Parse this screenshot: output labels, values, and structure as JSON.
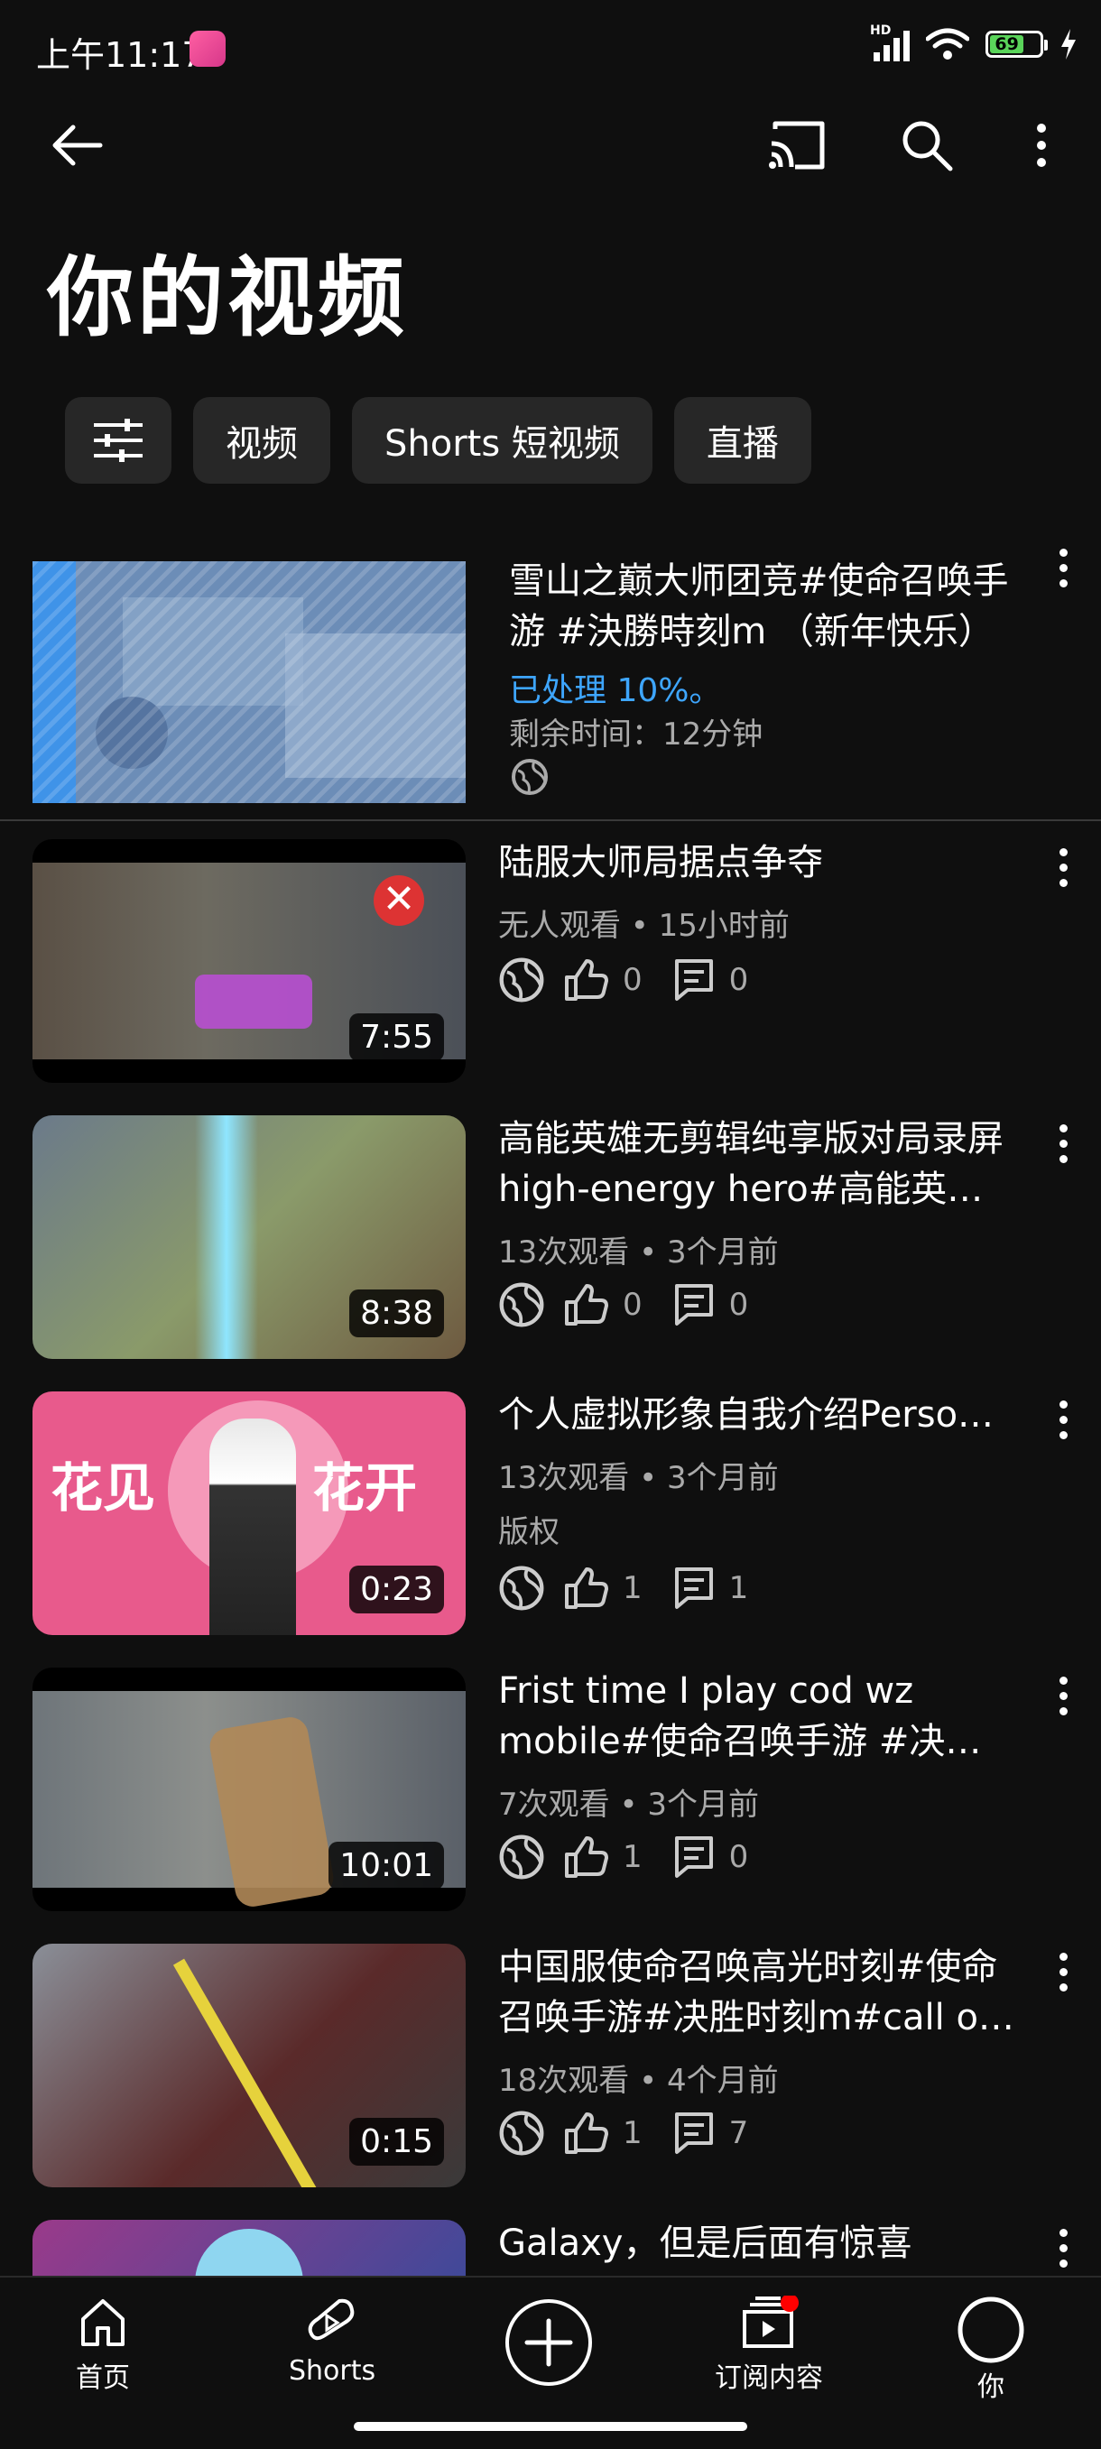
{
  "status_bar": {
    "time": "上午11:17",
    "battery": "69"
  },
  "page": {
    "title": "你的视频"
  },
  "chips": [
    "视频",
    "Shorts 短视频",
    "直播"
  ],
  "processing": {
    "title": "雪山之巅大师团竞#使命召唤手游 #決勝時刻m （新年快乐）",
    "status": "已处理 10%。",
    "remaining": "剩余时间：12分钟"
  },
  "videos": [
    {
      "title": "陆服大师局据点争夺",
      "views": "无人观看",
      "age": "15小时前",
      "extra": "",
      "likes": "0",
      "comments": "0",
      "duration": "7:55"
    },
    {
      "title": "高能英雄无剪辑纯享版对局录屏high-energy hero#高能英…",
      "views": "13次观看",
      "age": "3个月前",
      "extra": "",
      "likes": "0",
      "comments": "0",
      "duration": "8:38"
    },
    {
      "title": "个人虚拟形象自我介绍Perso…",
      "views": "13次观看",
      "age": "3个月前",
      "extra": "版权",
      "likes": "1",
      "comments": "1",
      "duration": "0:23",
      "thumb_text_left": "花见",
      "thumb_text_right": "花开"
    },
    {
      "title": "Frist time I play cod wz mobile#使命召唤手游 #决…",
      "views": "7次观看",
      "age": "3个月前",
      "extra": "",
      "likes": "1",
      "comments": "0",
      "duration": "10:01"
    },
    {
      "title": "中国服使命召唤高光时刻#使命召唤手游#决胜时刻m#call o…",
      "views": "18次观看",
      "age": "4个月前",
      "extra": "",
      "likes": "1",
      "comments": "7",
      "duration": "0:15"
    },
    {
      "title": "Galaxy，但是后面有惊喜"
    }
  ],
  "bottom_nav": {
    "home": "首页",
    "shorts": "Shorts",
    "subscriptions": "订阅内容",
    "you": "你"
  },
  "colors": {
    "background": "#0f0f0f",
    "chip": "#272727",
    "accent_blue": "#3ea6ff",
    "meta_gray": "#aaaaaa",
    "notification_red": "#ff0000"
  }
}
